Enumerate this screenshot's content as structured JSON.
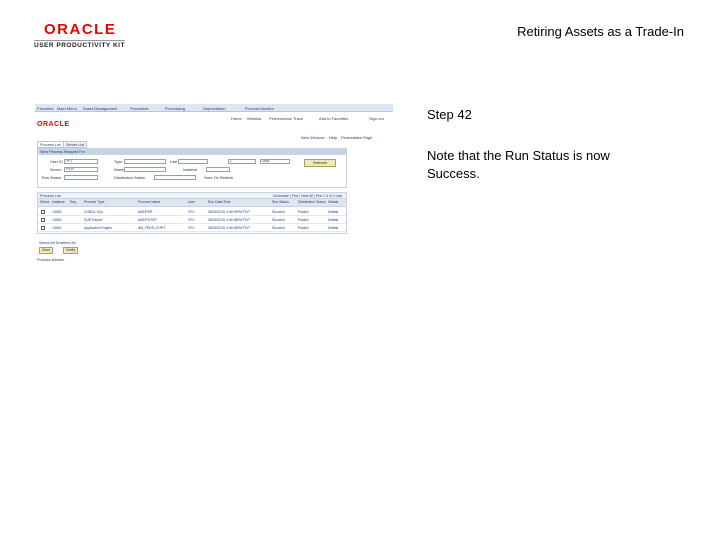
{
  "header": {
    "logo_text": "ORACLE",
    "logo_subtext": "USER PRODUCTIVITY KIT",
    "title": "Retiring Assets as a Trade-In"
  },
  "step": {
    "label": "Step 42",
    "instruction": "Note that the Run Status is now Success."
  },
  "screenshot": {
    "menu": [
      "Favorites",
      "Main Menu",
      "Asset Management",
      "Processes",
      "Processing",
      "Depreciation",
      "Process Monitor"
    ],
    "sublinks": [
      "Home",
      "Worklist",
      "Performance Trace",
      "Add to Favorites",
      "Sign out"
    ],
    "oracle_logo": "ORACLE",
    "top_links": [
      "New Window",
      "Help",
      "Personalize Page"
    ],
    "tabs": [
      "Process List",
      "Server List"
    ],
    "panel_title": "View Process Request For",
    "fields": {
      "user_id_label": "User ID",
      "user_id_value": "VP1",
      "type_label": "Type",
      "last_label": "Last",
      "last_value": "1",
      "unit_value": "Days",
      "server_label": "Server",
      "server_value": "PSNT",
      "name_label": "Name",
      "instance_label": "Instance",
      "run_status_label": "Run Status",
      "dist_status_label": "Distribution Status",
      "save_on_refresh": "Save On Refresh",
      "refresh_button": "Refresh"
    },
    "grid": {
      "title": "Process List",
      "nav": "Customize | Find | View All | First 1-3 of 3 Last",
      "columns": [
        "Select",
        "Instance",
        "Seq.",
        "Process Type",
        "Process Name",
        "User",
        "Run Date/Time",
        "Run Status",
        "Distribution Status",
        "Details"
      ],
      "rows": [
        {
          "instance": "13063",
          "type": "COBOL SQL",
          "name": "AMDPSR",
          "user": "VP1",
          "datetime": "06/22/2015 4:45:09PM PDT",
          "run_status": "Success",
          "dist_status": "Posted",
          "details": "Details"
        },
        {
          "instance": "13062",
          "type": "SQR Report",
          "name": "AMDPCSRT",
          "user": "VP1",
          "datetime": "06/22/2015 4:45:08PM PDT",
          "run_status": "Success",
          "dist_status": "Posted",
          "details": "Details"
        },
        {
          "instance": "13061",
          "type": "Application Engine",
          "name": "AM_FEED_COPY",
          "user": "VP1",
          "datetime": "06/22/2015 4:45:06PM PDT",
          "run_status": "Success",
          "dist_status": "Posted",
          "details": "Details"
        }
      ]
    },
    "select_links": "Select All   Deselect All",
    "bottom_buttons": [
      "Save",
      "Notify"
    ],
    "footer_link": "Process Monitor"
  }
}
